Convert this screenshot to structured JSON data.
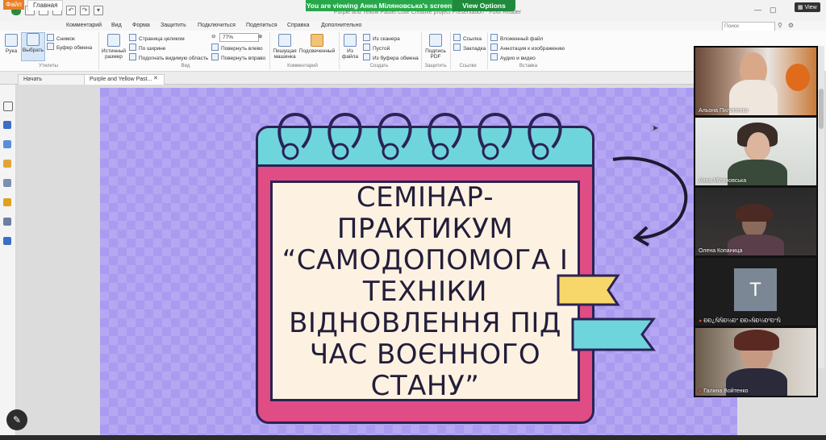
{
  "window": {
    "share_banner": "You are viewing Анна Міляновська's screen",
    "view_options": "View Options",
    "app_title": "Purple and Yellow Pastel Cute Creative project Presentation - Foxit Reader",
    "controls": [
      "—",
      "▢",
      "✕"
    ],
    "zoom_view": "View"
  },
  "menu": {
    "items": [
      "Файл",
      "Главная",
      "Комментарий",
      "Вид",
      "Форма",
      "Защитить",
      "Подключиться",
      "Поделиться",
      "Справка",
      "Дополнительно"
    ],
    "search_placeholder": "Поиск"
  },
  "ribbon": {
    "hand": "Рука",
    "select": "Выбрать",
    "snapshot": "Снимок",
    "clipboard": "Буфер обмена",
    "actual_size": "Истинный размер",
    "fit_page": "Страница целиком",
    "fit_width": "По ширине",
    "fit_visible": "Подогнать видимую область",
    "zoom_value": "77%",
    "rotate_left": "Повернуть влево",
    "rotate_right": "Повернуть вправо",
    "typewriter": "Пишущая машинка",
    "highlight": "Подсвеченный",
    "from_file": "Из файла",
    "from_scanner": "Из сканера",
    "blank": "Пустой",
    "from_clipboard": "Из буфера обмена",
    "sign_pdf": "Подпись PDF",
    "link": "Ссылка",
    "bookmark": "Закладка",
    "attached_file": "Вложенный файл",
    "image_annotation": "Аннотация к изображению",
    "audio_video": "Аудио и видео",
    "groups": [
      "Утилиты",
      "Вид",
      "Комментарий",
      "Создать",
      "Защитить",
      "Ссылки",
      "Вставка"
    ]
  },
  "tabs": {
    "start": "Начать",
    "doc": "Purple and Yellow Past..."
  },
  "slide": {
    "title_lines": [
      "СЕМІНАР-",
      "ПРАКТИКУМ",
      "“САМОДОПОМОГА І",
      "ТЕХНІКИ",
      "ВІДНОВЛЕННЯ ПІД",
      "ЧАС ВОЄННОГО",
      "СТАНУ”"
    ],
    "colors": {
      "background": "#ab9bf0",
      "calendar": "#e04c84",
      "calendar_top": "#6fd5dd",
      "paper": "#fdf2e1",
      "flag_yellow": "#f7d76a",
      "flag_cyan": "#6fd5dd",
      "ink": "#2a2355"
    }
  },
  "participants": [
    {
      "name": "Альона Пилипенко"
    },
    {
      "name": "Анна Міляновська"
    },
    {
      "name": "Олена Копаница"
    },
    {
      "name": "ÐÐ¿ÑÑÐ½Ð° ÐÐ»ÑÐ¼ÐºÐ°Ñ",
      "initial": "T"
    },
    {
      "name": "Галина Войтенко"
    }
  ],
  "icons": {
    "pen": "pen-icon"
  }
}
